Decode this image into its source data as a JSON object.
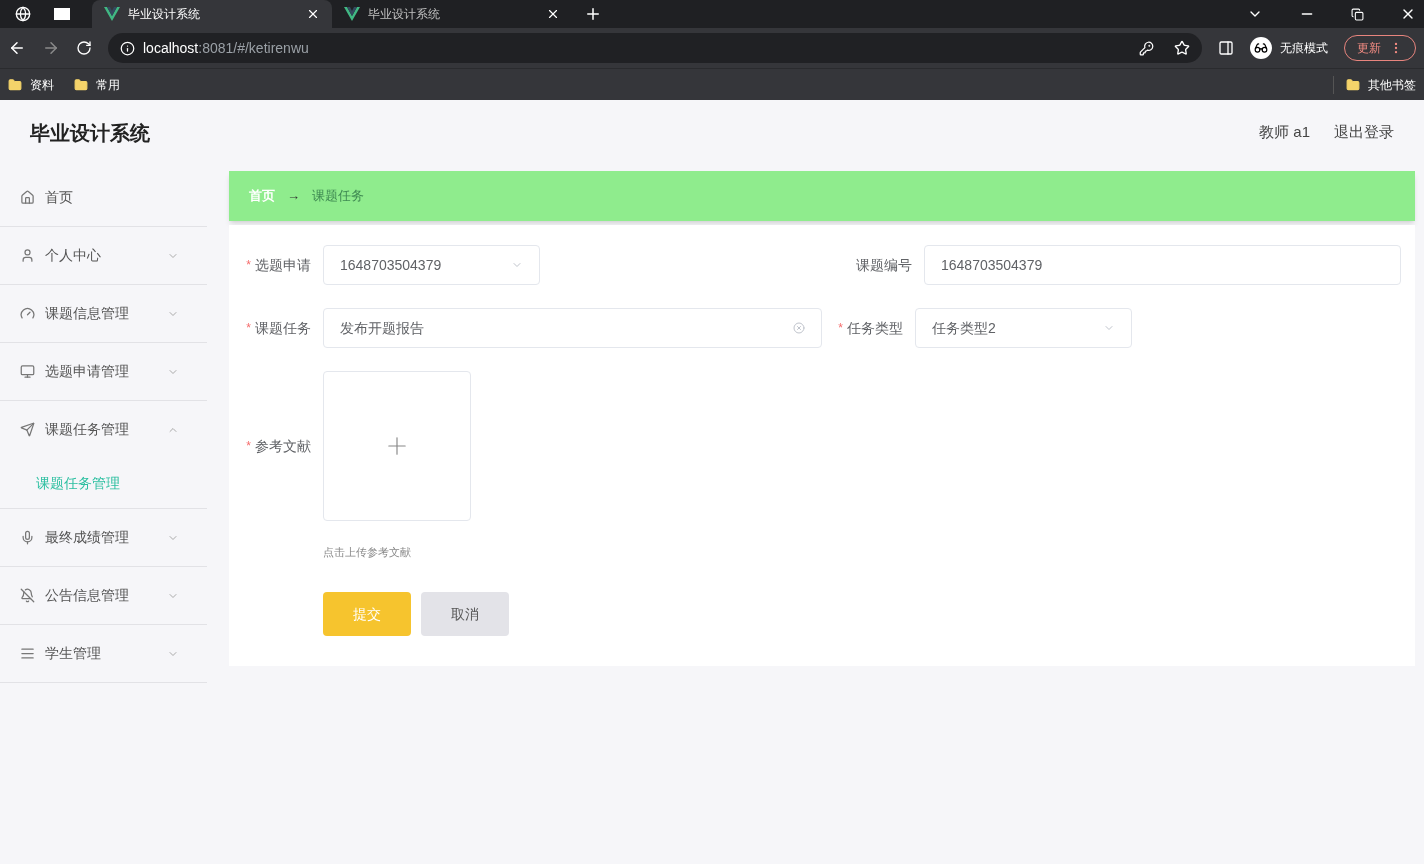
{
  "browser": {
    "tabs": [
      {
        "title": "毕业设计系统",
        "selected": true
      },
      {
        "title": "毕业设计系统",
        "selected": false
      }
    ],
    "url_host": "localhost",
    "url_path": ":8081/#/ketirenwu",
    "profile": "无痕模式",
    "update": "更新",
    "bookmarks": [
      "资料",
      "常用"
    ],
    "other_bookmarks": "其他书签"
  },
  "header": {
    "title": "毕业设计系统",
    "user": "教师 a1",
    "logout": "退出登录"
  },
  "sidebar": {
    "items": [
      {
        "label": "首页",
        "kind": "home"
      },
      {
        "label": "个人中心",
        "kind": "user",
        "expanded": false
      },
      {
        "label": "课题信息管理",
        "kind": "gauge",
        "expanded": false
      },
      {
        "label": "选题申请管理",
        "kind": "monitor",
        "expanded": false
      },
      {
        "label": "课题任务管理",
        "kind": "send",
        "expanded": true,
        "children": [
          {
            "label": "课题任务管理",
            "selected": true
          }
        ]
      },
      {
        "label": "最终成绩管理",
        "kind": "mic",
        "expanded": false
      },
      {
        "label": "公告信息管理",
        "kind": "bell",
        "expanded": false
      },
      {
        "label": "学生管理",
        "kind": "list",
        "expanded": false
      }
    ]
  },
  "breadcrumb": {
    "separator": "→",
    "items": [
      "首页",
      "课题任务"
    ]
  },
  "form": {
    "required_mark": "*",
    "topic_apply": {
      "label": "选题申请",
      "required": true,
      "value": "1648703504379"
    },
    "topic_no": {
      "label": "课题编号",
      "value": "1648703504379"
    },
    "task": {
      "label": "课题任务",
      "required": true,
      "value": "发布开题报告"
    },
    "task_type": {
      "label": "任务类型",
      "required": true,
      "value": "任务类型2"
    },
    "refs": {
      "label": "参考文献",
      "required": true,
      "hint": "点击上传参考文献"
    },
    "submit": "提交",
    "cancel": "取消"
  }
}
